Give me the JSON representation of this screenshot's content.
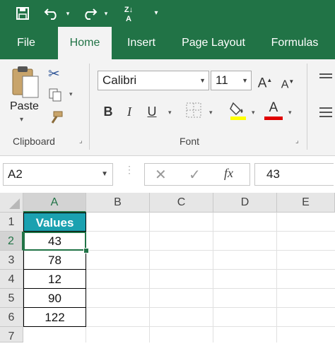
{
  "quick_access": {
    "icons": [
      "save-icon",
      "undo-icon",
      "redo-icon",
      "sort-az-icon",
      "customize-qat-icon"
    ]
  },
  "tabs": [
    {
      "label": "File"
    },
    {
      "label": "Home"
    },
    {
      "label": "Insert"
    },
    {
      "label": "Page Layout"
    },
    {
      "label": "Formulas"
    }
  ],
  "ribbon": {
    "clipboard": {
      "paste_label": "Paste",
      "group_label": "Clipboard"
    },
    "font": {
      "font_name": "Calibri",
      "font_size": "11",
      "bold": "B",
      "italic": "I",
      "underline": "U",
      "font_color_letter": "A",
      "grow_letter": "A",
      "shrink_letter": "A",
      "group_label": "Font",
      "highlight_color": "#ffff00",
      "font_color": "#e00000"
    }
  },
  "formula_bar": {
    "name_box": "A2",
    "fx_label": "fx",
    "formula": "43"
  },
  "grid": {
    "columns": [
      "A",
      "B",
      "C",
      "D",
      "E"
    ],
    "rows": [
      "1",
      "2",
      "3",
      "4",
      "5",
      "6",
      "7"
    ],
    "header_cell": "Values",
    "values": [
      "43",
      "78",
      "12",
      "90",
      "122"
    ],
    "active_cell": "A2",
    "header_fill": "#1ba1b0"
  },
  "colors": {
    "brand": "#217346"
  }
}
